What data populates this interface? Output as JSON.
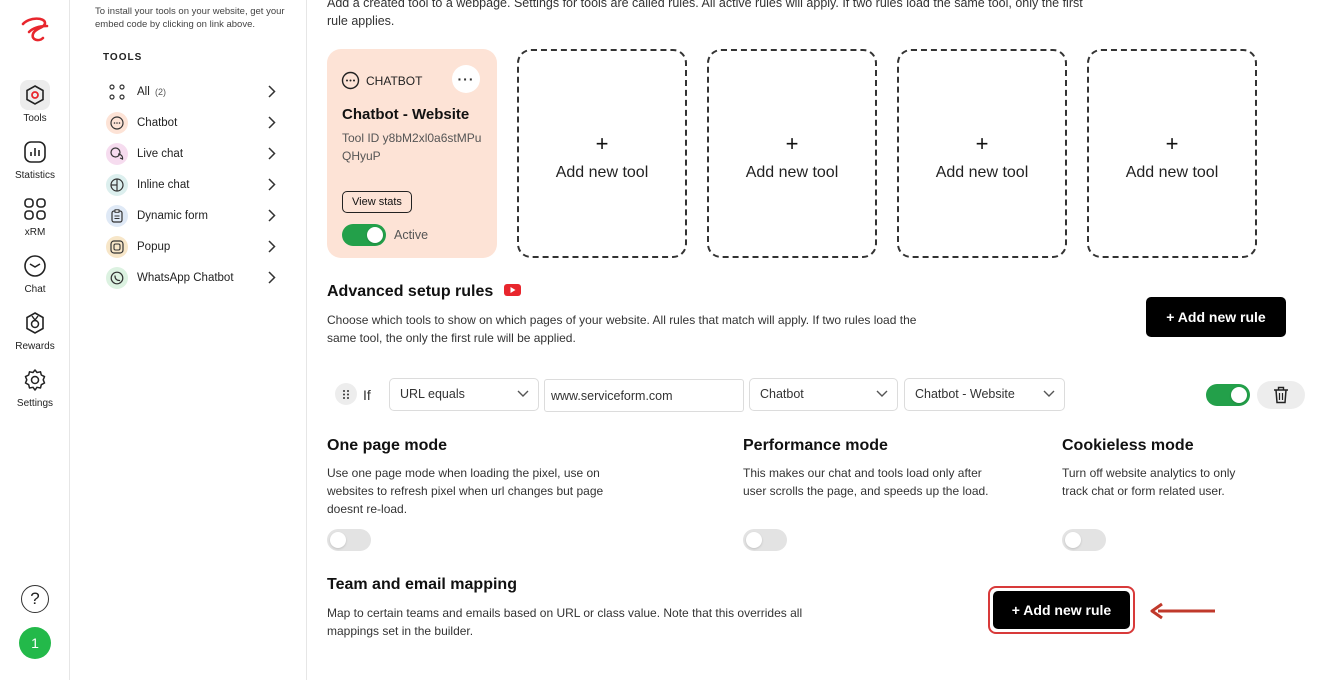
{
  "rail": {
    "items": [
      {
        "label": "Tools",
        "icon": "hexagon-tools-icon",
        "active": true
      },
      {
        "label": "Statistics",
        "icon": "bar-chart-icon"
      },
      {
        "label": "xRM",
        "icon": "grid-icon"
      },
      {
        "label": "Chat",
        "icon": "chat-bubble-icon"
      },
      {
        "label": "Rewards",
        "icon": "reward-icon"
      },
      {
        "label": "Settings",
        "icon": "gear-icon"
      }
    ],
    "help": "?",
    "avatar": "1"
  },
  "tools_panel": {
    "hint": "To install your tools on your website, get your embed code by clicking on link above.",
    "heading": "TOOLS",
    "items": [
      {
        "label": "All",
        "count": "(2)"
      },
      {
        "label": "Chatbot"
      },
      {
        "label": "Live chat"
      },
      {
        "label": "Inline chat"
      },
      {
        "label": "Dynamic form"
      },
      {
        "label": "Popup"
      },
      {
        "label": "WhatsApp Chatbot"
      }
    ]
  },
  "main": {
    "intro": "Add a created tool to a webpage. Settings for tools are called rules. All active rules will apply. If two rules load the same tool, only the first rule applies.",
    "tool_card": {
      "type": "CHATBOT",
      "more": "···",
      "name": "Chatbot - Website",
      "tool_id": "Tool ID y8bM2xl0a6stMPuQHyuP",
      "view_stats": "View stats",
      "status": "Active"
    },
    "add_tool": {
      "plus": "+",
      "label": "Add new tool"
    },
    "advanced": {
      "title": "Advanced setup rules",
      "desc": "Choose which tools to show on which pages of your website. All rules that match will apply. If two rules load the same tool, the only the first rule will be applied.",
      "add_rule": "+ Add new rule"
    },
    "rule": {
      "if": "If",
      "condition": "URL equals",
      "url": "www.serviceform.com",
      "tool_type": "Chatbot",
      "tool": "Chatbot - Website"
    },
    "modes": [
      {
        "title": "One page mode",
        "desc": "Use one page mode when loading the pixel, use on websites to refresh pixel when url changes but page doesnt re-load."
      },
      {
        "title": "Performance mode",
        "desc": "This makes our chat and tools load only after user scrolls the page, and speeds up the load."
      },
      {
        "title": "Cookieless mode",
        "desc": "Turn off website analytics to only track chat or form related user."
      }
    ],
    "team": {
      "title": "Team and email mapping",
      "desc": "Map to certain teams and emails based on URL or class value. Note that this overrides all mappings set in the builder.",
      "add_rule": "+ Add new rule"
    }
  },
  "colors": {
    "accent_red": "#e8262d",
    "active_green": "#23a04a",
    "card_peach": "#fde3d6",
    "highlight_red": "#d83a3a"
  }
}
